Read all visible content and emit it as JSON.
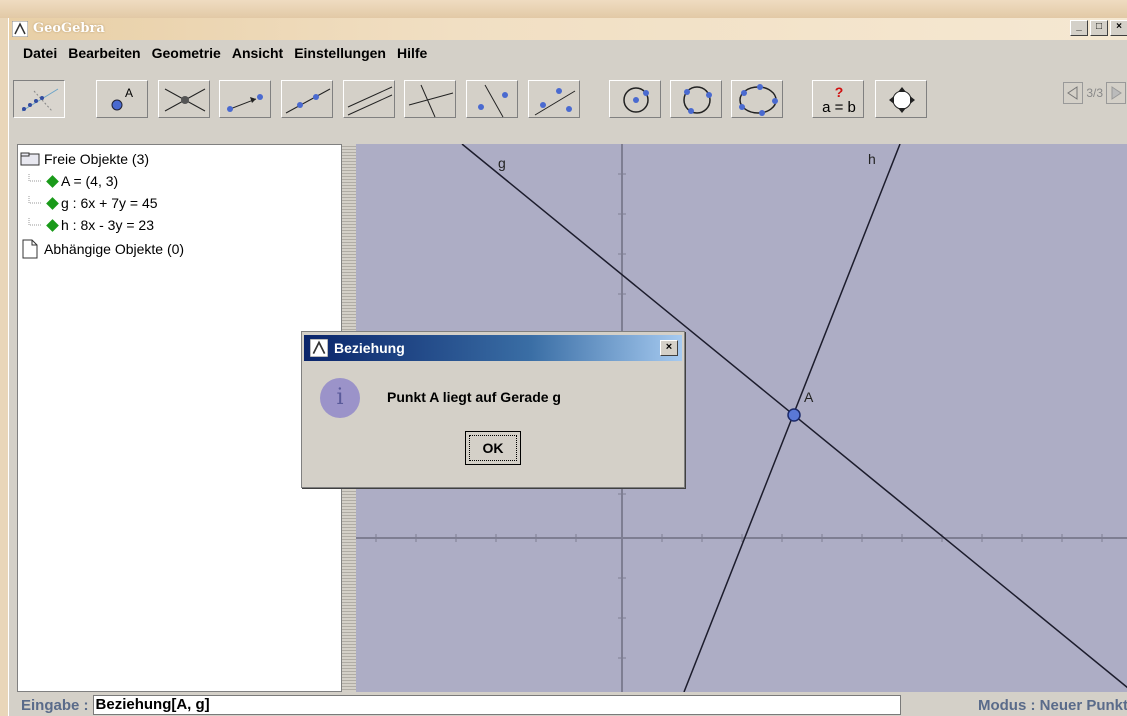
{
  "window": {
    "title": "GeoGebra",
    "controls": [
      "_",
      "□",
      "×"
    ]
  },
  "menu": [
    "Datei",
    "Bearbeiten",
    "Geometrie",
    "Ansicht",
    "Einstellungen",
    "Hilfe"
  ],
  "toolbar": {
    "tools": [
      {
        "name": "move-graphics-view"
      },
      {
        "name": "new-point",
        "label": "A"
      },
      {
        "name": "intersect-two-objects"
      },
      {
        "name": "vector-between-two-points"
      },
      {
        "name": "line-through-two-points"
      },
      {
        "name": "parallel-line"
      },
      {
        "name": "perpendicular-line"
      },
      {
        "name": "perpendicular-bisector"
      },
      {
        "name": "line-bisector"
      },
      {
        "name": "circle-with-center"
      },
      {
        "name": "circle-through-three-points"
      },
      {
        "name": "conic-through-five-points"
      },
      {
        "name": "relation-tool",
        "label_top": "?",
        "label": "a = b"
      },
      {
        "name": "move-drawing-pad"
      }
    ],
    "pager": "3/3"
  },
  "algebra": {
    "free_header": "Freie Objekte (3)",
    "objects": [
      "A = (4, 3)",
      "g : 6x + 7y = 45",
      "h : 8x - 3y = 23"
    ],
    "dependent_header": "Abhängige Objekte (0)"
  },
  "graphics": {
    "labels": {
      "g": "g",
      "h": "h",
      "A": "A"
    },
    "colors": {
      "background": "#adadc5",
      "axes": "#7e7e92",
      "point": "#5a78d6"
    }
  },
  "dialog": {
    "title": "Beziehung",
    "close": "×",
    "message": "Punkt A liegt auf Gerade g",
    "ok": "OK"
  },
  "inputbar": {
    "label": "Eingabe :",
    "value": "Beziehung[A, g]",
    "mode": "Modus : Neuer Punkt"
  }
}
